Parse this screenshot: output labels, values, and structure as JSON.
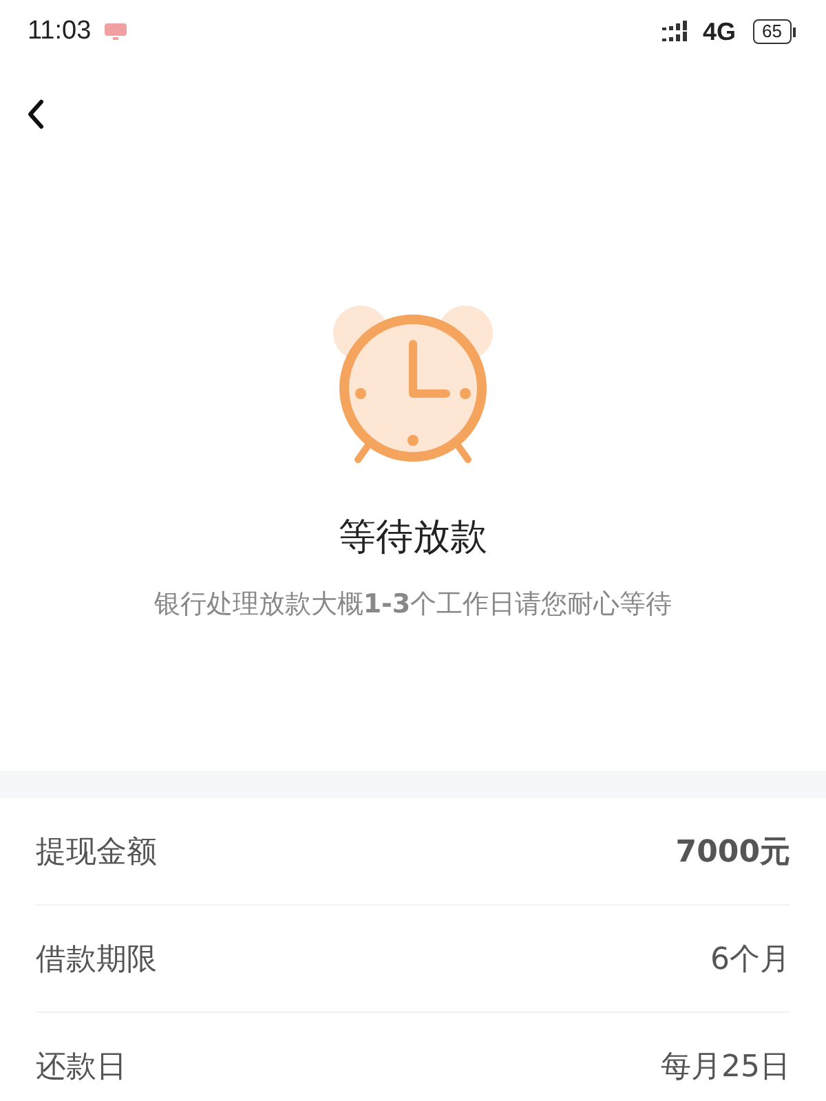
{
  "status_bar": {
    "time": "11:03",
    "network": "4G",
    "battery": "65"
  },
  "status": {
    "title": "等待放款",
    "message": "银行处理放款大概**1-3**个工作日请您耐心等待"
  },
  "details": [
    {
      "label": "提现金额",
      "value": "7000元",
      "emphasis": true
    },
    {
      "label": "借款期限",
      "value": "6个月",
      "emphasis": false
    },
    {
      "label": "还款日",
      "value": "每月25日",
      "emphasis": false
    }
  ]
}
